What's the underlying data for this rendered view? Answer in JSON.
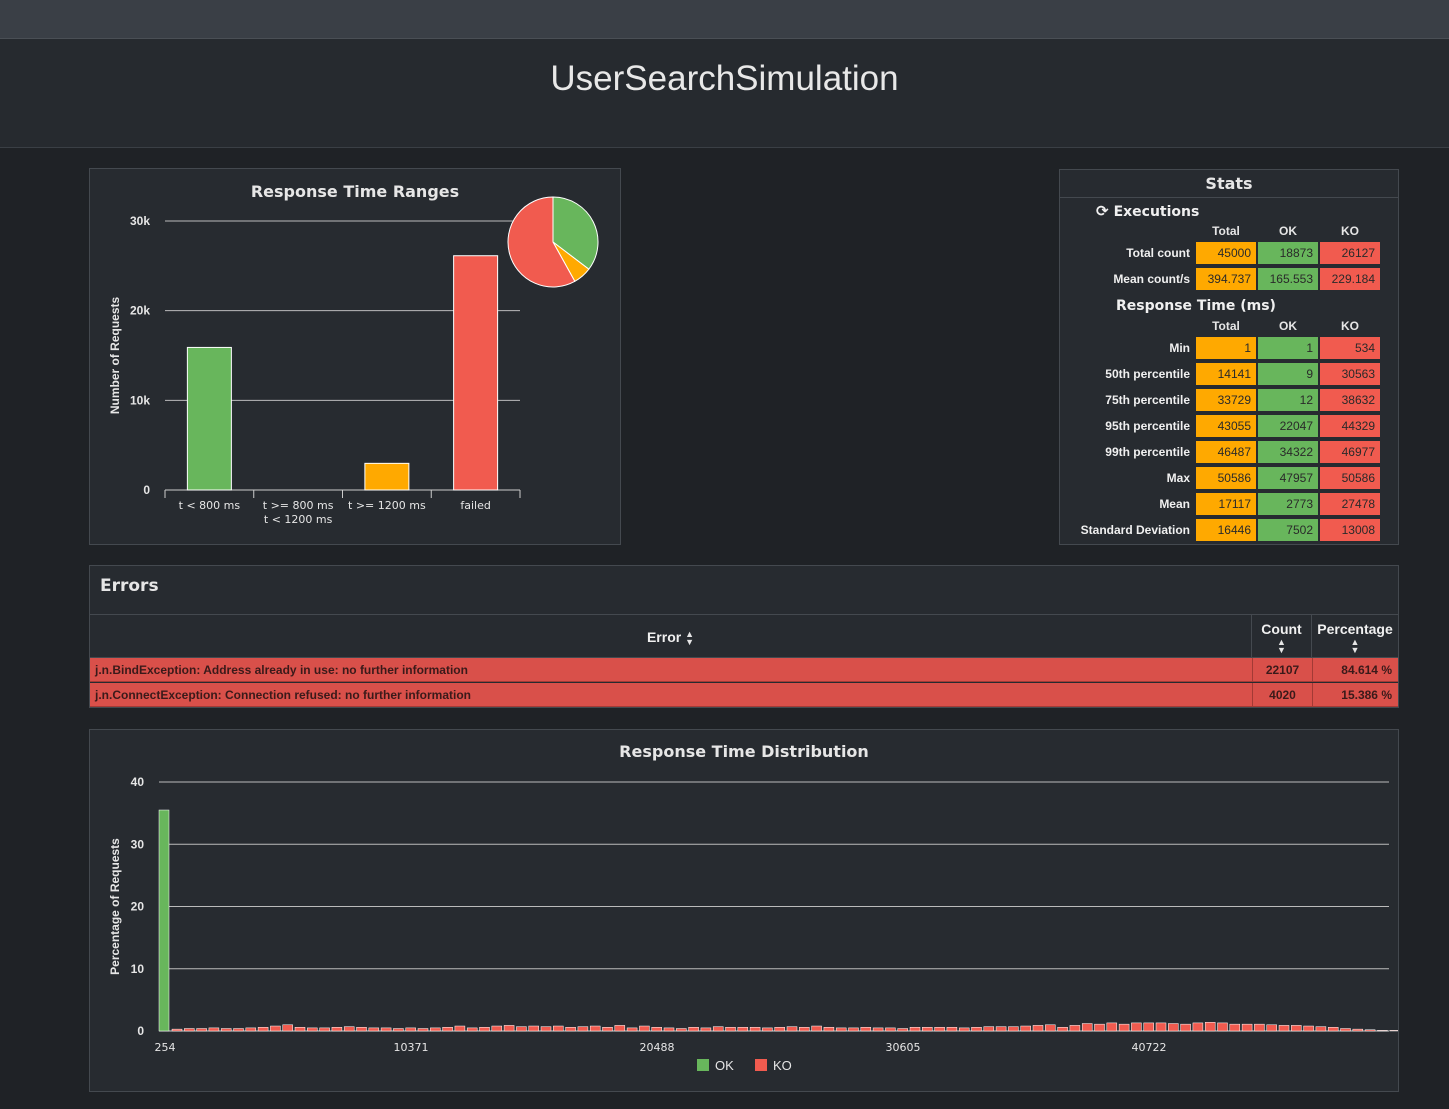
{
  "page": {
    "title": "UserSearchSimulation"
  },
  "ranges": {
    "title": "Response Time Ranges",
    "ylabel": "Number of Requests",
    "chart_data": {
      "type": "bar",
      "categories": [
        [
          "t < 800 ms"
        ],
        [
          "t >= 800 ms",
          "t < 1200 ms"
        ],
        [
          "t >= 1200 ms"
        ],
        [
          "failed"
        ]
      ],
      "values": [
        15900,
        0,
        2973,
        26127
      ],
      "colors": [
        "#68b65c",
        "#68b65c",
        "#ffa900",
        "#f15b4f"
      ],
      "ylim": [
        0,
        30000
      ],
      "yticks": [
        {
          "v": 0,
          "label": "0"
        },
        {
          "v": 10000,
          "label": "10k"
        },
        {
          "v": 20000,
          "label": "20k"
        },
        {
          "v": 30000,
          "label": "30k"
        }
      ],
      "pie": [
        {
          "label": "t < 800 ms",
          "value": 15900,
          "color": "#68b65c"
        },
        {
          "label": "t >= 800 ms t < 1200 ms",
          "value": 0,
          "color": "#ffa900"
        },
        {
          "label": "t >= 1200 ms",
          "value": 2973,
          "color": "#ffa900"
        },
        {
          "label": "failed",
          "value": 26127,
          "color": "#f15b4f"
        }
      ]
    }
  },
  "stats": {
    "title": "Stats",
    "executions_label": "Executions",
    "columns": [
      "Total",
      "OK",
      "KO"
    ],
    "executions": [
      {
        "label": "Total count",
        "total": "45000",
        "ok": "18873",
        "ko": "26127"
      },
      {
        "label": "Mean count/s",
        "total": "394.737",
        "ok": "165.553",
        "ko": "229.184"
      }
    ],
    "response_label": "Response Time (ms)",
    "response": [
      {
        "label": "Min",
        "total": "1",
        "ok": "1",
        "ko": "534"
      },
      {
        "label": "50th percentile",
        "total": "14141",
        "ok": "9",
        "ko": "30563"
      },
      {
        "label": "75th percentile",
        "total": "33729",
        "ok": "12",
        "ko": "38632"
      },
      {
        "label": "95th percentile",
        "total": "43055",
        "ok": "22047",
        "ko": "44329"
      },
      {
        "label": "99th percentile",
        "total": "46487",
        "ok": "34322",
        "ko": "46977"
      },
      {
        "label": "Max",
        "total": "50586",
        "ok": "47957",
        "ko": "50586"
      },
      {
        "label": "Mean",
        "total": "17117",
        "ok": "2773",
        "ko": "27478"
      },
      {
        "label": "Standard Deviation",
        "total": "16446",
        "ok": "7502",
        "ko": "13008"
      }
    ]
  },
  "errors": {
    "title": "Errors",
    "headers": {
      "error": "Error",
      "count": "Count",
      "percentage": "Percentage"
    },
    "rows": [
      {
        "error": "j.n.BindException: Address already in use: no further information",
        "count": "22107",
        "percentage": "84.614 %"
      },
      {
        "error": "j.n.ConnectException: Connection refused: no further information",
        "count": "4020",
        "percentage": "15.386 %"
      }
    ]
  },
  "distribution": {
    "title": "Response Time Distribution",
    "ylabel": "Percentage of Requests",
    "legend": [
      {
        "name": "OK",
        "color": "#68b65c"
      },
      {
        "name": "KO",
        "color": "#f15b4f"
      }
    ],
    "chart_data": {
      "type": "bar",
      "xlabel_ticks": [
        "254",
        "10371",
        "20488",
        "30605",
        "40722"
      ],
      "ylim": [
        0,
        40
      ],
      "yticks": [
        0,
        10,
        20,
        30,
        40
      ],
      "series": [
        {
          "name": "OK",
          "values": [
            35.5
          ]
        },
        {
          "name": "KO",
          "values": [
            0.3,
            0.4,
            0.4,
            0.5,
            0.4,
            0.4,
            0.5,
            0.6,
            0.8,
            1.0,
            0.6,
            0.5,
            0.5,
            0.6,
            0.7,
            0.6,
            0.5,
            0.5,
            0.4,
            0.5,
            0.4,
            0.5,
            0.6,
            0.8,
            0.5,
            0.6,
            0.8,
            0.9,
            0.7,
            0.8,
            0.7,
            0.8,
            0.6,
            0.7,
            0.8,
            0.6,
            0.9,
            0.5,
            0.8,
            0.6,
            0.5,
            0.4,
            0.6,
            0.5,
            0.7,
            0.6,
            0.6,
            0.6,
            0.5,
            0.6,
            0.7,
            0.6,
            0.8,
            0.6,
            0.5,
            0.5,
            0.6,
            0.5,
            0.5,
            0.4,
            0.6,
            0.6,
            0.6,
            0.6,
            0.5,
            0.6,
            0.7,
            0.7,
            0.7,
            0.8,
            0.9,
            1.0,
            0.6,
            0.9,
            1.2,
            1.1,
            1.3,
            1.1,
            1.3,
            1.3,
            1.3,
            1.2,
            1.1,
            1.3,
            1.4,
            1.3,
            1.1,
            1.1,
            1.1,
            1.0,
            0.9,
            0.9,
            0.8,
            0.7,
            0.6,
            0.4,
            0.3,
            0.2,
            0.1,
            0.1
          ]
        }
      ]
    }
  }
}
